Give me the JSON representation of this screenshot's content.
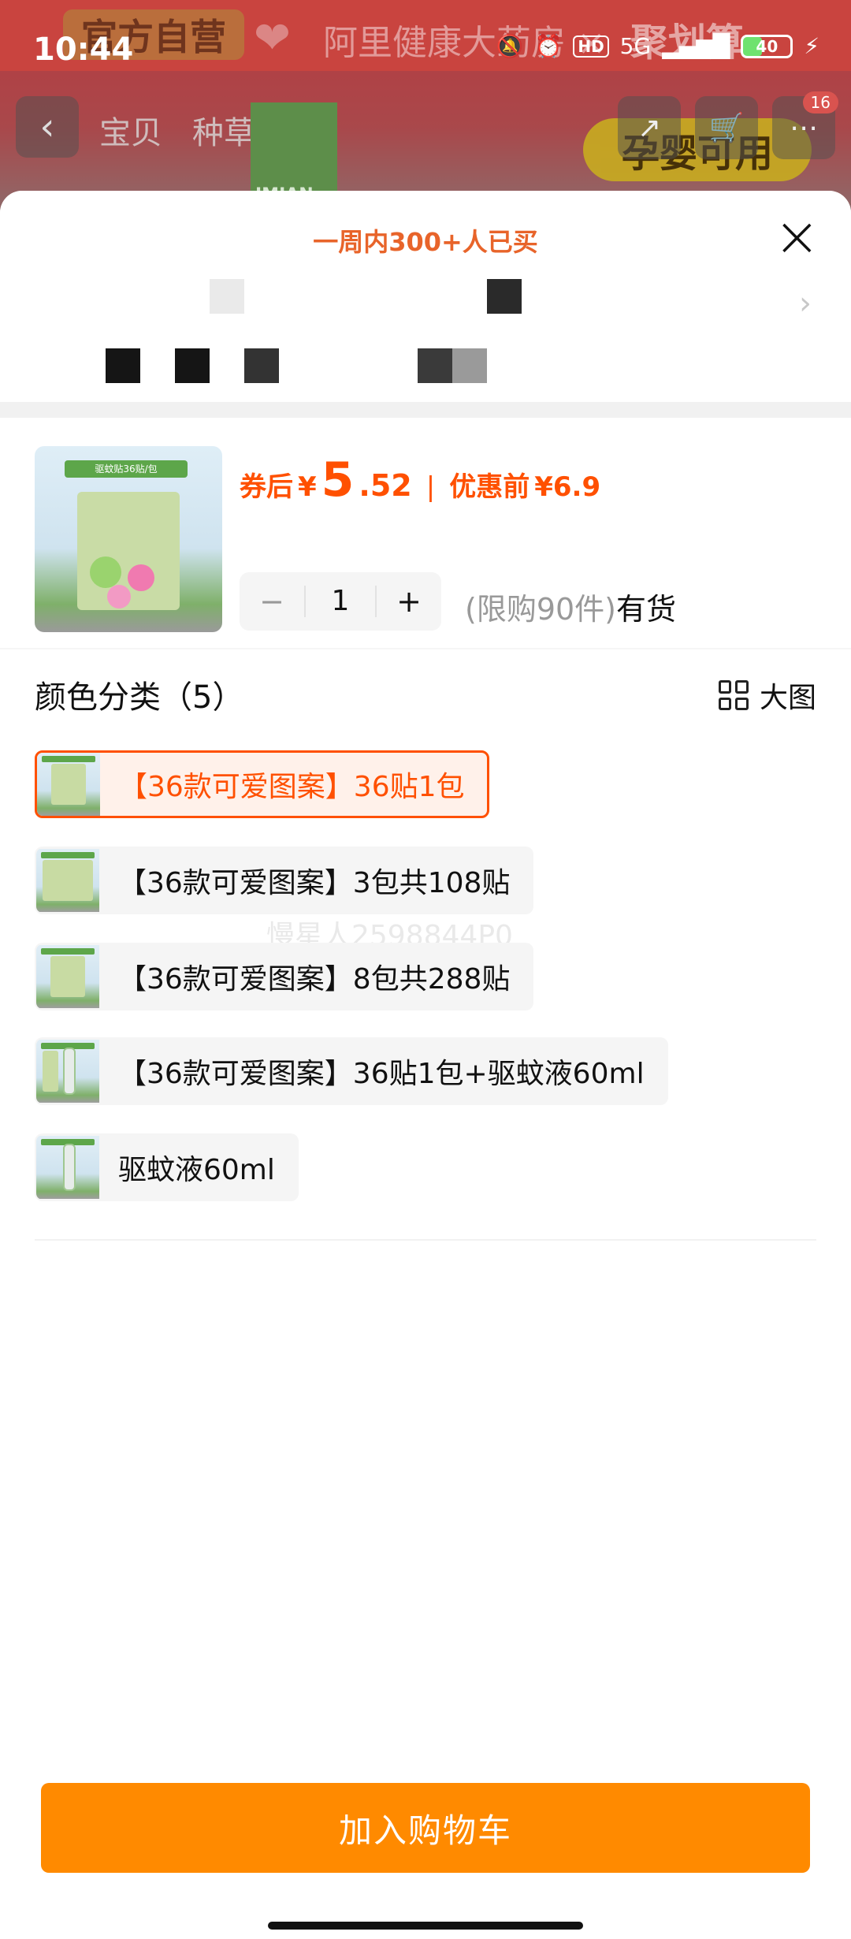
{
  "status_bar": {
    "time": "10:44",
    "network": "5G",
    "hd": "HD",
    "battery": "40"
  },
  "background_page": {
    "banner_official": "官方自营",
    "banner_title": "阿里健康大药房",
    "banner_cross": "×",
    "banner_tag": "聚划算",
    "nav_tabs": [
      "宝贝",
      "种草"
    ],
    "product_brand": "JMIAN",
    "badge_text": "孕婴可用",
    "cart_count": "16"
  },
  "sheet": {
    "bought_text": "一周内300+人已买",
    "close_icon": "close-icon",
    "price": {
      "prefix": "券后",
      "currency": "¥",
      "integer": "5",
      "decimal": ".52",
      "separator": "|",
      "before_label": "优惠前",
      "before_value": "¥6.9"
    },
    "product_thumb_label": "驱蚊贴36贴/包",
    "quantity": {
      "minus": "−",
      "value": "1",
      "plus": "+"
    },
    "stock": {
      "limit": "(限购90件)",
      "availability": "有货"
    },
    "variants_title": "颜色分类（5）",
    "big_view_label": "大图",
    "variants": [
      {
        "label": "【36款可爱图案】36贴1包",
        "selected": true
      },
      {
        "label": "【36款可爱图案】3包共108贴",
        "selected": false
      },
      {
        "label": "【36款可爱图案】8包共288贴",
        "selected": false
      },
      {
        "label": "【36款可爱图案】36贴1包+驱蚊液60ml",
        "selected": false
      },
      {
        "label": "驱蚊液60ml",
        "selected": false
      }
    ],
    "watermark": "慢星人2598844P0",
    "add_to_cart": "加入购物车"
  },
  "colors": {
    "accent_orange": "#ff5000",
    "cta_orange": "#ff8a00"
  }
}
